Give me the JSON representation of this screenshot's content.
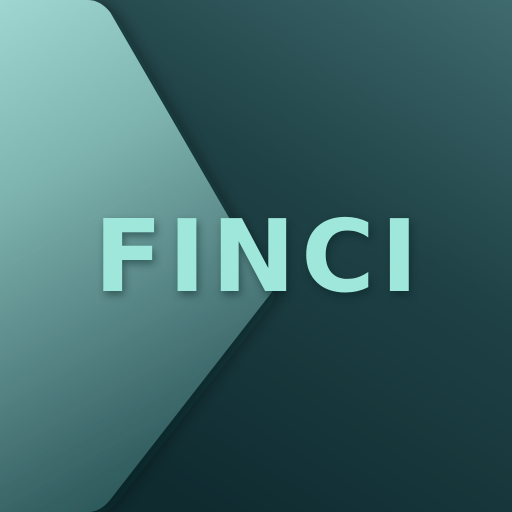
{
  "logo": {
    "text": "FINCI"
  },
  "colors": {
    "background_light": "#3f6a6e",
    "background_dark": "#0f2b30",
    "chevron_light": "#9fd6d1",
    "chevron_dark": "#3e6a6c",
    "text": "#9fe7da"
  }
}
